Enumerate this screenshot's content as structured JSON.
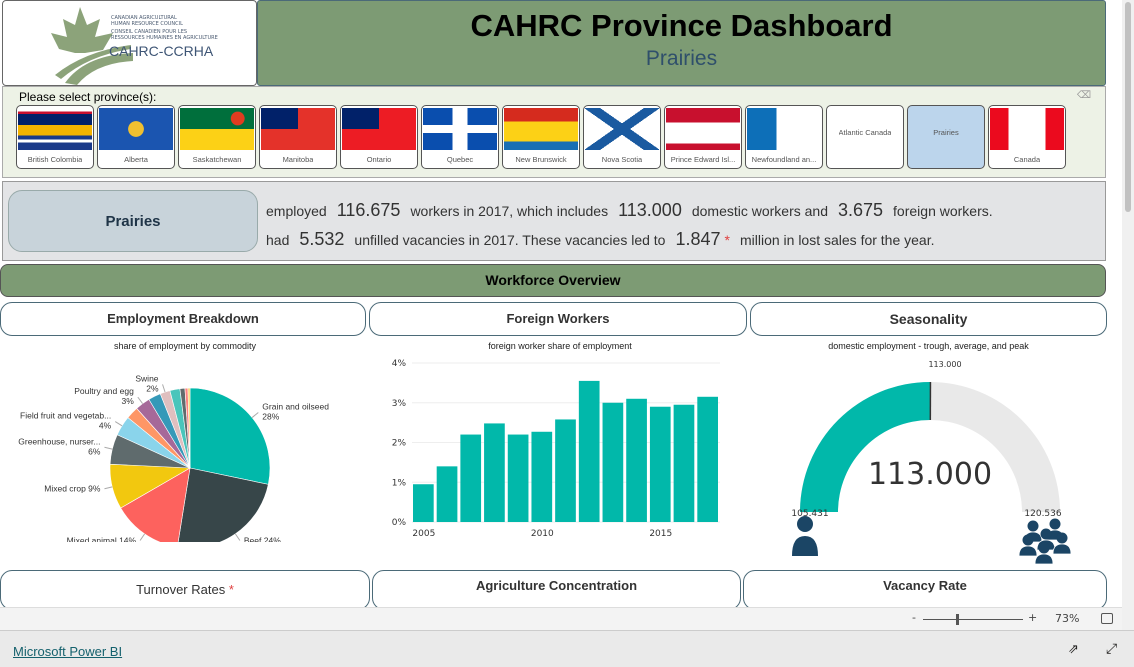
{
  "header": {
    "title": "CAHRC Province Dashboard",
    "subtitle": "Prairies",
    "logo_text": "CAHRC-CCRHA",
    "logo_lines": [
      "CANADIAN AGRICULTURAL",
      "HUMAN RESOURCE COUNCIL",
      "CONSEIL CANADIEN POUR LES",
      "RESSOURCES HUMAINES EN AGRICULTURE"
    ]
  },
  "slicer": {
    "label": "Please select province(s):",
    "selected": "Prairies",
    "items": [
      {
        "name": "British Colombia",
        "flag": "bc"
      },
      {
        "name": "Alberta",
        "flag": "ab"
      },
      {
        "name": "Saskatchewan",
        "flag": "sk"
      },
      {
        "name": "Manitoba",
        "flag": "mb"
      },
      {
        "name": "Ontario",
        "flag": "on"
      },
      {
        "name": "Quebec",
        "flag": "qc"
      },
      {
        "name": "New Brunswick",
        "flag": "nb"
      },
      {
        "name": "Nova Scotia",
        "flag": "ns"
      },
      {
        "name": "Prince Edward Isl...",
        "flag": "pe"
      },
      {
        "name": "Newfoundland an...",
        "flag": "nl"
      },
      {
        "name": "Atlantic Canada",
        "flag": ""
      },
      {
        "name": "Prairies",
        "flag": ""
      },
      {
        "name": "Canada",
        "flag": "ca"
      }
    ]
  },
  "summary": {
    "region": "Prairies",
    "l1": [
      "employed",
      "116.675",
      "workers in 2017, which includes",
      "113.000",
      "domestic workers and",
      "3.675",
      "foreign workers."
    ],
    "l2": [
      "had",
      "5.532",
      "unfilled vacancies in 2017.  These vacancies led to",
      "1.847",
      "*",
      "million in lost sales for the year."
    ]
  },
  "section": "Workforce Overview",
  "cards": {
    "employment": "Employment Breakdown",
    "foreign": "Foreign Workers",
    "seasonality": "Seasonality",
    "turnover": "Turnover Rates",
    "turnover_star": "*",
    "concentration": "Agriculture Concentration",
    "vacancy": "Vacancy Rate"
  },
  "chart_data": [
    {
      "type": "pie",
      "title": "share of employment by commodity",
      "slices": [
        {
          "label": "Grain and oilseed",
          "value": 28,
          "pct": "28%",
          "color": "#01b8aa"
        },
        {
          "label": "Beef",
          "value": 24,
          "pct": "24%",
          "color": "#374649"
        },
        {
          "label": "Mixed animal",
          "value": 14,
          "pct": "14%",
          "color": "#fd625e"
        },
        {
          "label": "Mixed crop",
          "value": 9,
          "pct": "9%",
          "color": "#f2c80f"
        },
        {
          "label": "Greenhouse, nurser...",
          "value": 6,
          "pct": "6%",
          "color": "#5f6b6d"
        },
        {
          "label": "Field fruit and vegetab...",
          "value": 4,
          "pct": "4%",
          "color": "#8ad4eb"
        },
        {
          "label": "",
          "value": 2.5,
          "pct": "",
          "color": "#fe9666"
        },
        {
          "label": "Poultry and egg",
          "value": 3,
          "pct": "3%",
          "color": "#a66999"
        },
        {
          "label": "",
          "value": 2.5,
          "pct": "",
          "color": "#3599b8"
        },
        {
          "label": "Swine",
          "value": 2,
          "pct": "2%",
          "color": "#dfbfbf"
        },
        {
          "label": "",
          "value": 2,
          "pct": "",
          "color": "#4ac5bb"
        },
        {
          "label": "",
          "value": 1,
          "pct": "",
          "color": "#5f6b6d"
        },
        {
          "label": "",
          "value": 0.6,
          "pct": "",
          "color": "#fb8281"
        },
        {
          "label": "",
          "value": 0.4,
          "pct": "",
          "color": "#f4d25a"
        }
      ]
    },
    {
      "type": "bar",
      "title": "foreign worker share of employment",
      "x": [
        2005,
        2006,
        2007,
        2008,
        2009,
        2010,
        2011,
        2012,
        2013,
        2014,
        2015,
        2016,
        2017
      ],
      "values": [
        0.95,
        1.4,
        2.2,
        2.48,
        2.2,
        2.27,
        2.58,
        3.55,
        3.0,
        3.1,
        2.9,
        2.95,
        3.15
      ],
      "ylim": [
        0,
        4
      ],
      "yticks": [
        "0%",
        "1%",
        "2%",
        "3%",
        "4%"
      ],
      "xticks": [
        "2005",
        "2010",
        "2015"
      ],
      "color": "#01b8aa",
      "grid": true
    },
    {
      "type": "gauge",
      "title": "domestic employment - trough, average, and peak",
      "min": "105.431",
      "max": "120.536",
      "value": "113.000",
      "target": "113.000",
      "min_v": 105.431,
      "max_v": 120.536,
      "value_v": 113.0,
      "fill": "#01b8aa"
    }
  ],
  "zoom": {
    "level": "73%",
    "minus": "-",
    "plus": "+"
  },
  "footer": {
    "link": "Microsoft Power BI"
  }
}
